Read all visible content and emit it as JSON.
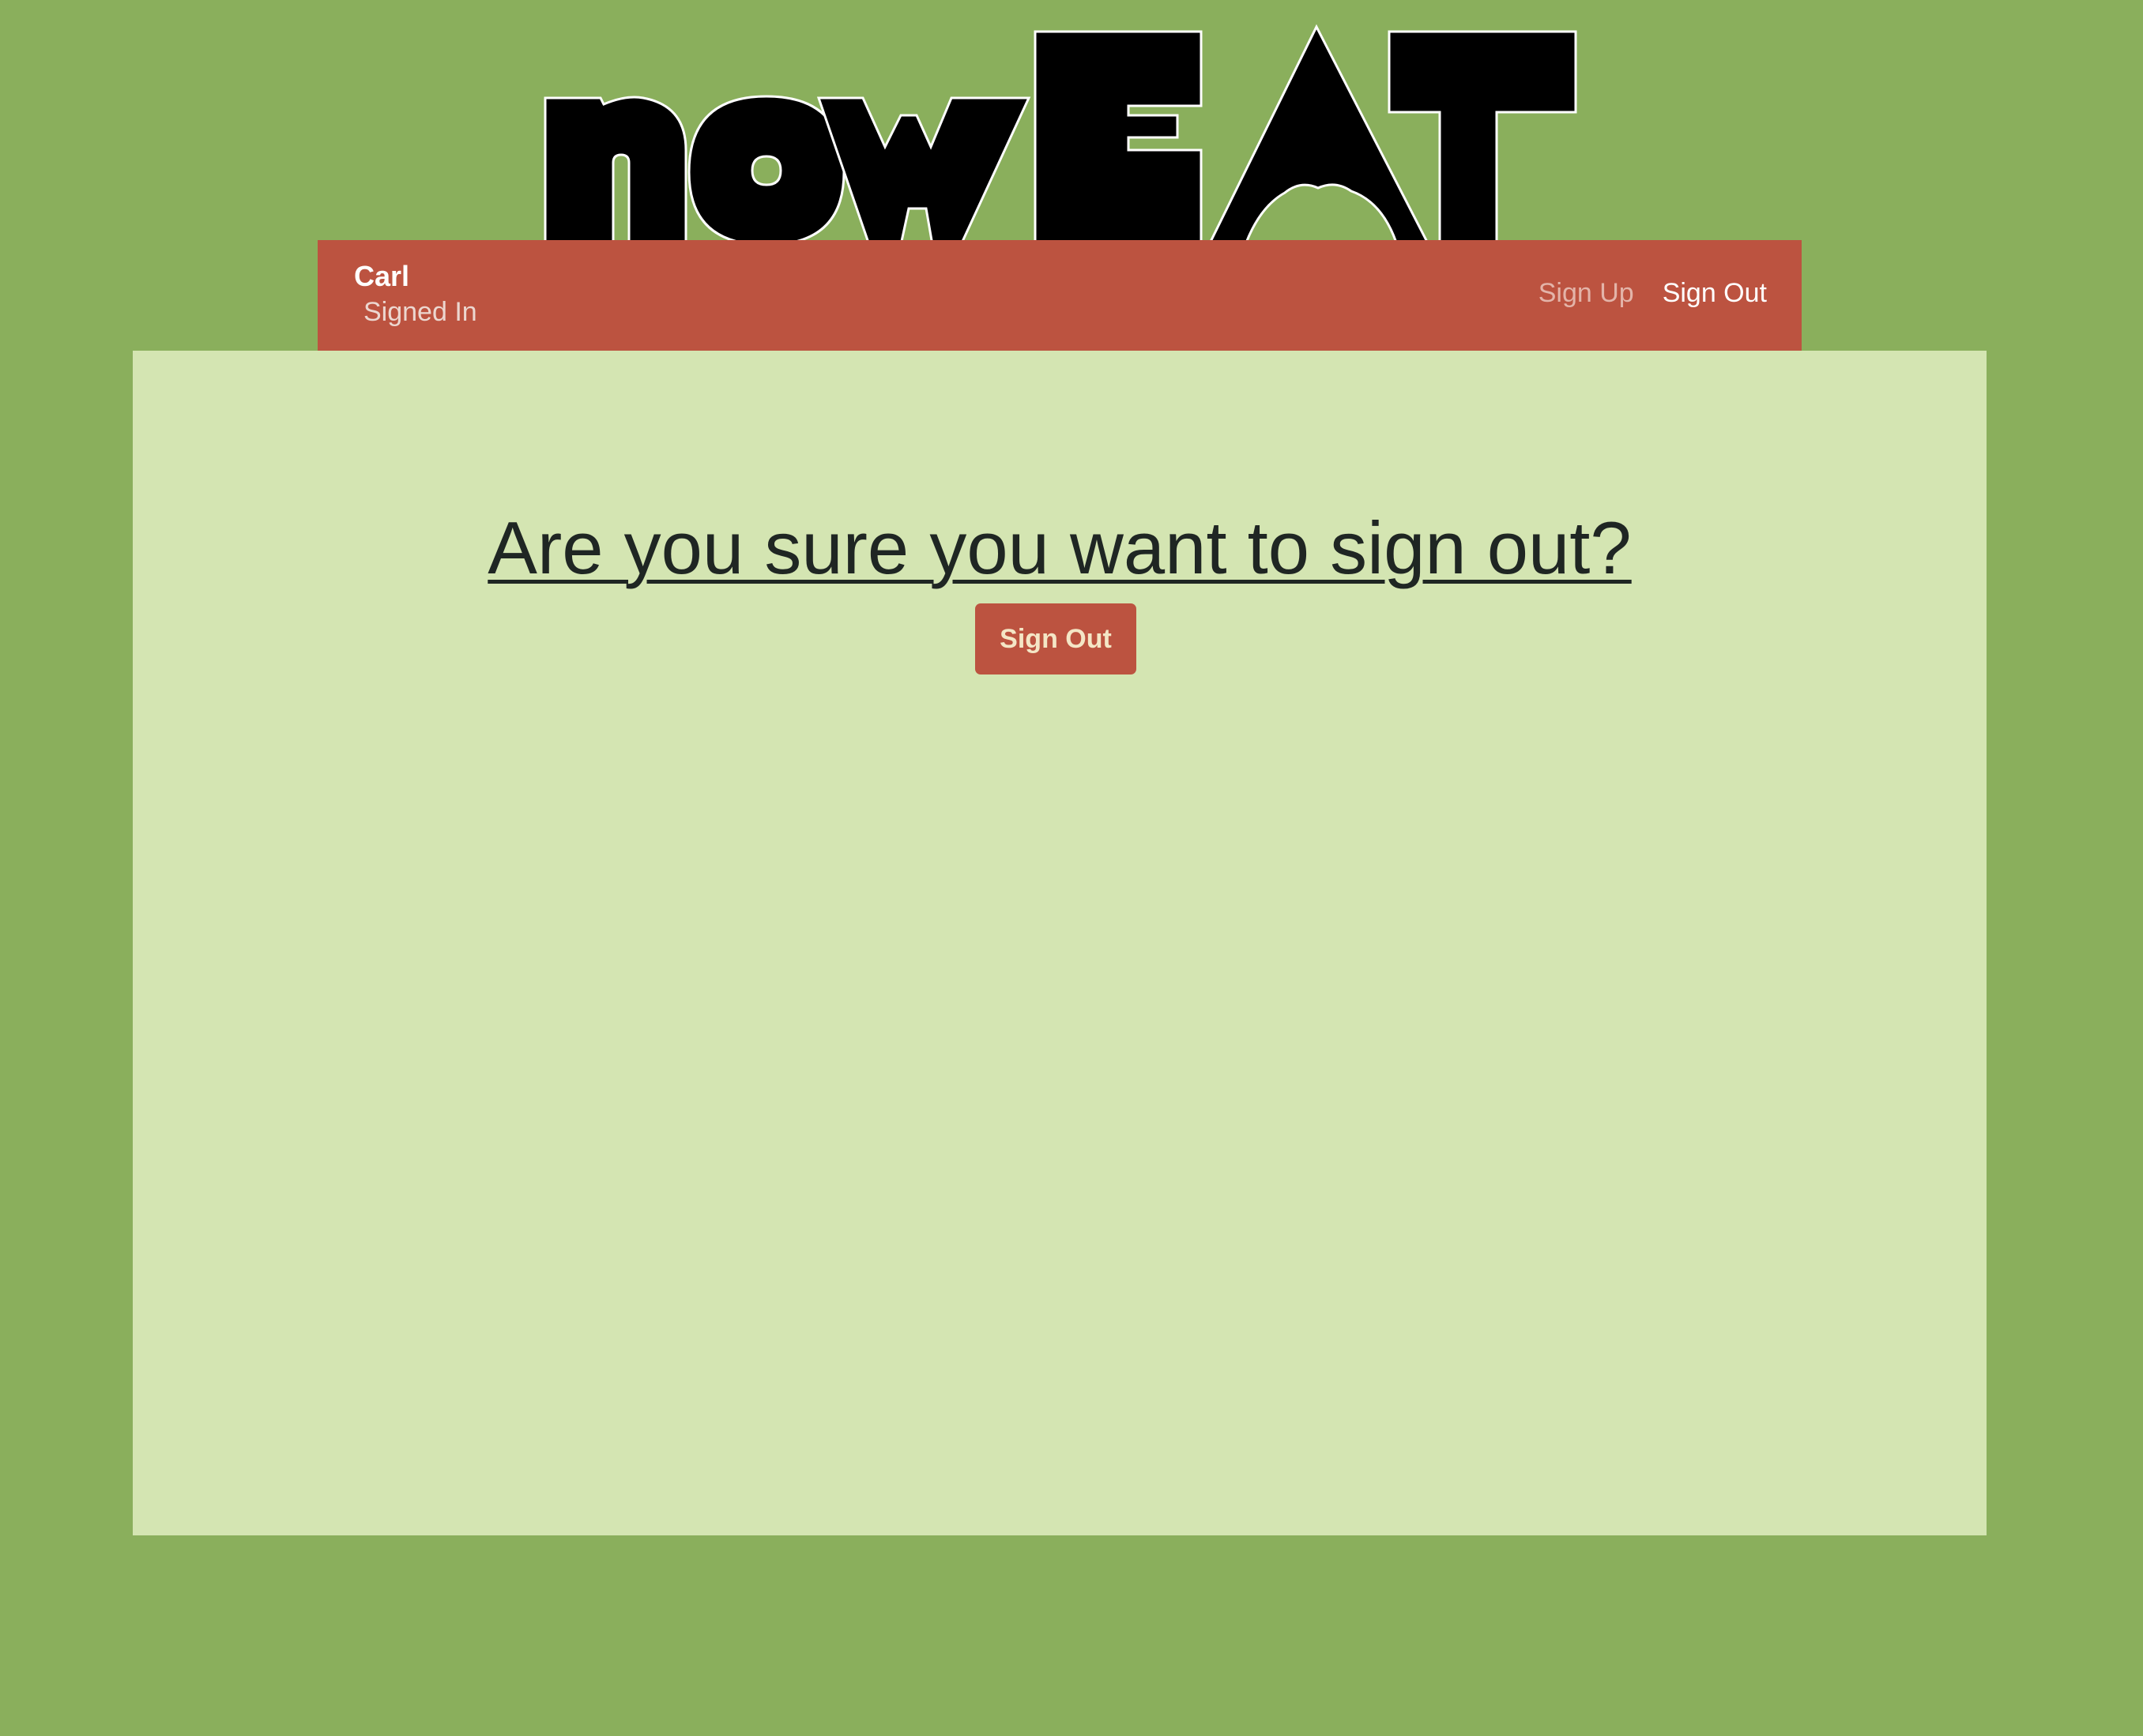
{
  "logo": {
    "alt": "nowEAT",
    "text_lower": "now",
    "text_upper": "EAT"
  },
  "header": {
    "user_name": "Carl",
    "user_status": "Signed In",
    "nav": {
      "signup_label": "Sign Up",
      "signout_label": "Sign Out"
    }
  },
  "main": {
    "heading": "Are you sure you want to sign out?",
    "signout_button_label": "Sign Out"
  },
  "colors": {
    "page_background": "#8aaf5c",
    "navbar": "#bc5340",
    "content_panel": "#d4e5b2",
    "button": "#bc5340",
    "button_text": "#f4e6c6",
    "heading_text": "#1f2623"
  }
}
